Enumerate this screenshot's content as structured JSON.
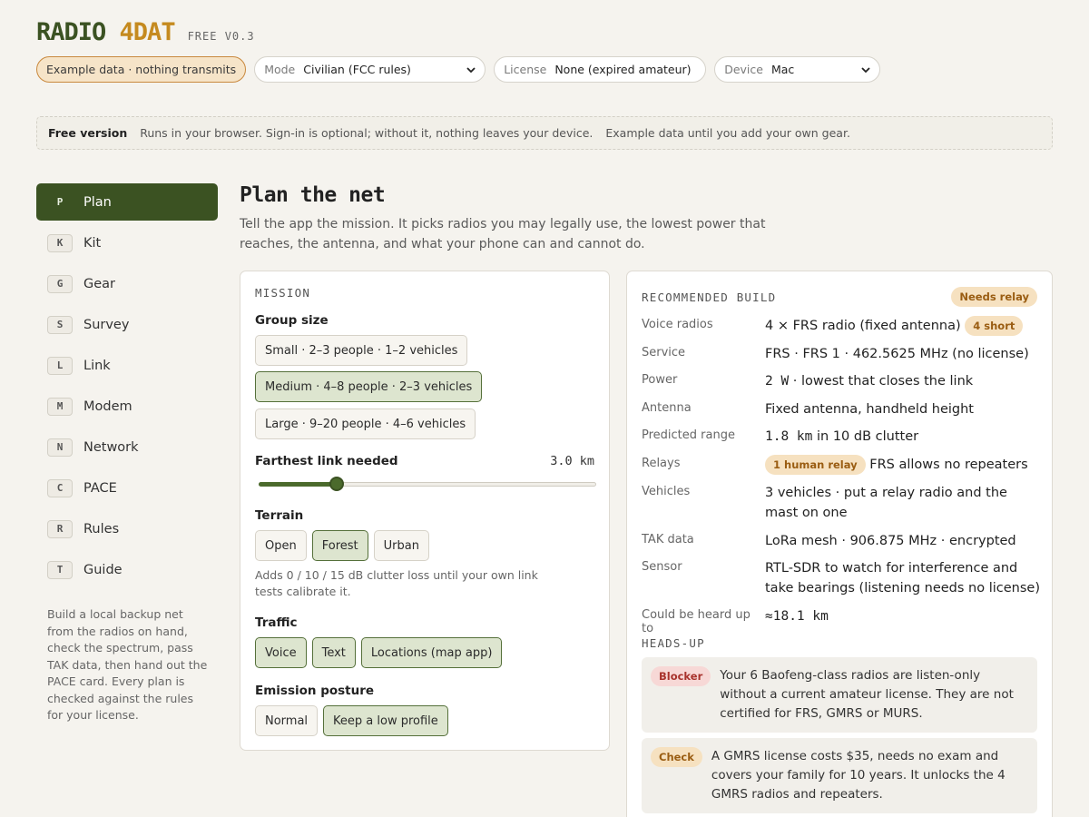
{
  "app": {
    "name_a": "RADIO",
    "name_b": "4DAT",
    "version": "FREE V0.3"
  },
  "topbar": {
    "example_pill": "Example data · nothing transmits",
    "mode": {
      "label": "Mode",
      "value": "Civilian (FCC rules)"
    },
    "license": {
      "label": "License",
      "value": "None (expired amateur)"
    },
    "device": {
      "label": "Device",
      "value": "Mac"
    }
  },
  "banner": {
    "title": "Free version",
    "text1": "Runs in your browser. Sign-in is optional; without it, nothing leaves your device.",
    "text2": "Example data until you add your own gear."
  },
  "sidebar": {
    "items": [
      {
        "key": "P",
        "label": "Plan"
      },
      {
        "key": "K",
        "label": "Kit"
      },
      {
        "key": "G",
        "label": "Gear"
      },
      {
        "key": "S",
        "label": "Survey"
      },
      {
        "key": "L",
        "label": "Link"
      },
      {
        "key": "M",
        "label": "Modem"
      },
      {
        "key": "N",
        "label": "Network"
      },
      {
        "key": "C",
        "label": "PACE"
      },
      {
        "key": "R",
        "label": "Rules"
      },
      {
        "key": "T",
        "label": "Guide"
      }
    ],
    "active_index": 0,
    "note": "Build a local backup net from the radios on hand, check the spectrum, pass TAK data, then hand out the PACE card. Every plan is checked against the rules for your license."
  },
  "main": {
    "title": "Plan the net",
    "subtitle": "Tell the app the mission. It picks radios you may legally use, the lowest power that reaches, the antenna, and what your phone can and cannot do."
  },
  "mission": {
    "heading": "MISSION",
    "group_size": {
      "label": "Group size",
      "options": [
        "Small · 2–3 people · 1–2 vehicles",
        "Medium · 4–8 people · 2–3 vehicles",
        "Large · 9–20 people · 4–6 vehicles"
      ],
      "selected": 1
    },
    "farthest": {
      "label": "Farthest link needed",
      "value": "3.0 km",
      "fraction": 0.23
    },
    "terrain": {
      "label": "Terrain",
      "options": [
        "Open",
        "Forest",
        "Urban"
      ],
      "selected": 1,
      "hint": "Adds 0 / 10 / 15 dB clutter loss until your own link tests calibrate it."
    },
    "traffic": {
      "label": "Traffic",
      "options": [
        "Voice",
        "Text",
        "Locations (map app)"
      ]
    },
    "emission": {
      "label": "Emission posture",
      "options": [
        "Normal",
        "Keep a low profile"
      ],
      "selected": 1
    }
  },
  "build": {
    "heading": "RECOMMENDED BUILD",
    "status_badge": "Needs relay",
    "rows": {
      "voice": {
        "k": "Voice radios",
        "v": "4 × FRS radio (fixed antenna)",
        "badge": "4 short"
      },
      "service": {
        "k": "Service",
        "v": "FRS · FRS 1 · 462.5625 MHz (no license)"
      },
      "power": {
        "k": "Power",
        "num": "2 W",
        "v": " · lowest that closes the link"
      },
      "antenna": {
        "k": "Antenna",
        "v": "Fixed antenna, handheld height"
      },
      "range": {
        "k": "Predicted range",
        "num": "1.8 km",
        "v": " in 10 dB clutter"
      },
      "relays": {
        "k": "Relays",
        "badge": "1 human relay",
        "v": "FRS allows no repeaters"
      },
      "vehicles": {
        "k": "Vehicles",
        "v": "3 vehicles · put a relay radio and the mast on one"
      },
      "tak": {
        "k": "TAK data",
        "v": "LoRa mesh · 906.875 MHz · encrypted"
      },
      "sensor": {
        "k": "Sensor",
        "v": "RTL-SDR to watch for interference and take bearings (listening needs no license)"
      },
      "heard": {
        "k": "Could be heard up to",
        "num": "≈18.1 km"
      }
    },
    "headsup_heading": "HEADS-UP",
    "alerts": [
      {
        "tag": "Blocker",
        "text": "Your 6 Baofeng-class radios are listen-only without a current amateur license. They are not certified for FRS, GMRS or MURS."
      },
      {
        "tag": "Check",
        "text": "A GMRS license costs $35, needs no exam and covers your family for 10 years. It unlocks the 4 GMRS radios and repeaters."
      }
    ]
  },
  "colors": {
    "accent_green": "#3b5222",
    "accent_gold": "#c58a1f",
    "selected_chip": "#dde5cf",
    "amber_badge": "#f6e1c0",
    "red_badge": "#f7d8d6"
  }
}
